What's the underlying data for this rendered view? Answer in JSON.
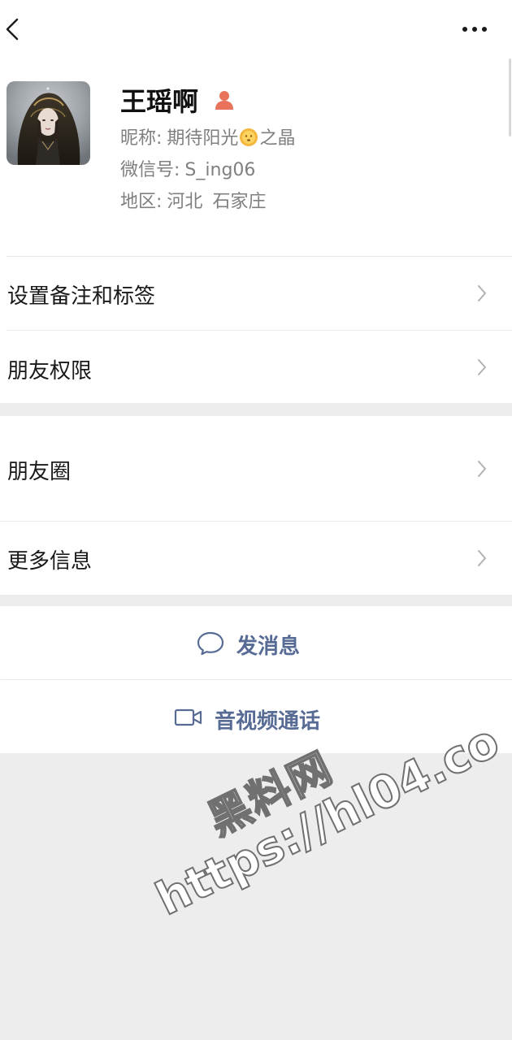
{
  "profile": {
    "name": "王瑶啊",
    "nickname_label": "昵称:",
    "nickname_before_emoji": "期待阳光",
    "nickname_emoji": "sun-face-emoji",
    "nickname_after_emoji": "之晶",
    "wechat_id_label": "微信号:",
    "wechat_id": "S_ing06",
    "region_label": "地区:",
    "region_province": "河北",
    "region_city": "石家庄",
    "gender_icon": "female-person-icon",
    "gender_color": "#e8735a"
  },
  "nav": {
    "back_icon": "chevron-left-icon",
    "more_icon": "more-dots-icon"
  },
  "menu": {
    "items": [
      {
        "label": "设置备注和标签"
      },
      {
        "label": "朋友权限"
      },
      {
        "label": "朋友圈"
      },
      {
        "label": "更多信息"
      }
    ]
  },
  "actions": {
    "message_label": "发消息",
    "call_label": "音视频通话",
    "link_color": "#576b95"
  },
  "watermark": {
    "line1": "黑料网",
    "line2": "https://hl04.co"
  },
  "colors": {
    "background": "#ededed",
    "surface": "#ffffff",
    "secondary_text": "#7f7f7f"
  }
}
